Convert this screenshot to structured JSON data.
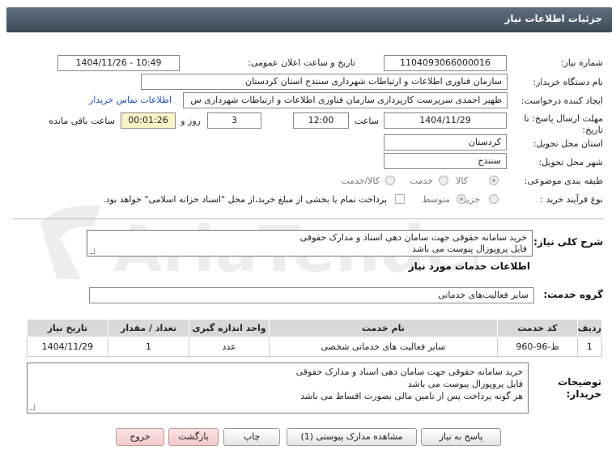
{
  "header": {
    "title": "جزئیات اطلاعات نیاز"
  },
  "form": {
    "need_number_label": "شماره نیاز:",
    "need_number": "1104093066000016",
    "announce_label": "تاریخ و ساعت اعلان عمومی:",
    "announce_value": "1404/11/26 - 10:49",
    "buyer_org_label": "نام دستگاه خریدار:",
    "buyer_org": "سازمان فناوری اطلاعات و ارتباطات شهرداری سنندج استان کردستان",
    "creator_label": "ایجاد کننده درخواست:",
    "creator": "ظهیر احمدی سرپرست کارپردازی سازمان فناوری اطلاعات و ارتباطات شهرداری س",
    "contact_link": "اطلاعات تماس خریدار",
    "deadline_label_1": "مهلت ارسال پاسخ: تا",
    "deadline_label_2": "تاریخ:",
    "deadline_date": "1404/11/29",
    "time_label": "ساعت",
    "deadline_time": "12:00",
    "days_value": "3",
    "days_label": "روز و",
    "remaining_value": "00:01:26",
    "remaining_label": "ساعت باقی مانده",
    "province_label": "استان محل تحویل:",
    "province": "کردستان",
    "city_label": "شهر محل تحویل:",
    "city": "سنندج",
    "category_label": "طبقه بندی موضوعی:",
    "category_options": [
      "کالا",
      "خدمت",
      "کالا/خدمت"
    ],
    "process_label": "نوع فرآیند خرید :",
    "process_options": [
      "جزیی",
      "متوسط"
    ],
    "payment_note": "پرداخت تمام یا بخشی از مبلغ خرید،از محل \"اسناد خزانه اسلامی\" خواهد بود."
  },
  "summary": {
    "label": "شرح کلی نیاز:",
    "lines": [
      "خرید سامانه حقوقی جهت سامان دهی اسناد و مدارک حقوقی",
      "فایل پروپوزال پیوست می باشد"
    ]
  },
  "services": {
    "title": "اطلاعات خدمات مورد نیاز",
    "group_label": "گروه خدمت:",
    "group_value": "سایر فعالیت‌های خدماتی",
    "columns": [
      "ردیف",
      "کد خدمت",
      "نام خدمت",
      "واحد اندازه گیری",
      "تعداد / مقدار",
      "تاریخ نیاز"
    ],
    "rows": [
      [
        "1",
        "ط-96-960",
        "سایر فعالیت های خدماتی شخصی",
        "عدد",
        "1",
        "1404/11/29"
      ]
    ]
  },
  "buyer_notes": {
    "label_1": "توضیحات",
    "label_2": "خریدار:",
    "lines": [
      "خرید سامانه حقوقی جهت سامان دهی اسناد و مدارک حقوقی",
      "فایل پروپوزال پیوست می باشد",
      "هر گونه پرداخت پس از تامین مالی بصورت اقساط می باشد"
    ]
  },
  "buttons": {
    "reply": "پاسخ به نیاز",
    "attachments": "مشاهده مدارک پیوستی (1)",
    "print": "چاپ",
    "back": "بازگشت",
    "exit": "خروج"
  },
  "watermark": {
    "text": "AriaTender.neT"
  },
  "colors": {
    "header": "#4a5866",
    "link": "#1a4fc9",
    "timer_bg": "#fbf4c9",
    "watermark": "#e9e9e9"
  }
}
